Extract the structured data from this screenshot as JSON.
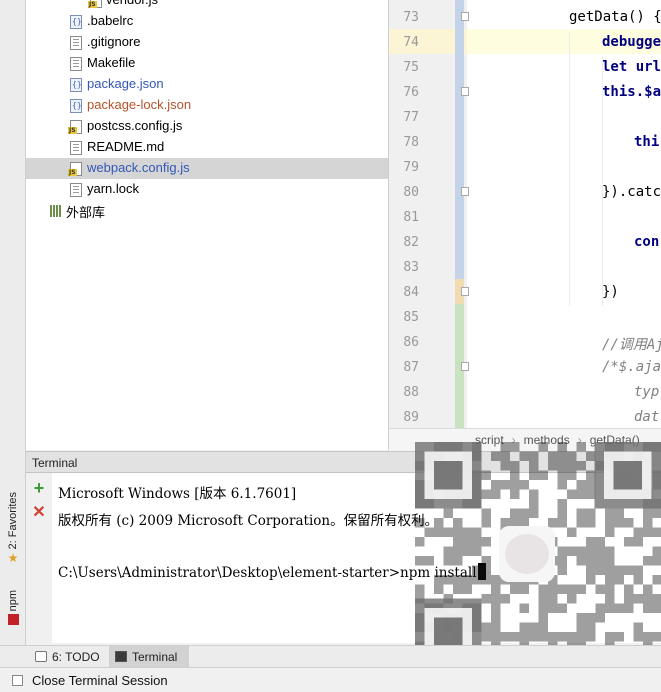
{
  "side_tabs": {
    "favorites": "2: Favorites",
    "npm": "npm"
  },
  "project_tree": {
    "items": [
      {
        "name": "vendor.js",
        "icon": "js-file-icon",
        "color": "#000000"
      },
      {
        "name": ".babelrc",
        "icon": "json-file-icon",
        "color": "#000000"
      },
      {
        "name": ".gitignore",
        "icon": "text-file-icon",
        "color": "#000000"
      },
      {
        "name": "Makefile",
        "icon": "text-file-icon",
        "color": "#000000"
      },
      {
        "name": "package.json",
        "icon": "json-file-icon",
        "color": "#3357b8"
      },
      {
        "name": "package-lock.json",
        "icon": "json-file-icon",
        "color": "#b5532a"
      },
      {
        "name": "postcss.config.js",
        "icon": "js-file-icon",
        "color": "#000000"
      },
      {
        "name": "README.md",
        "icon": "text-file-icon",
        "color": "#000000"
      },
      {
        "name": "webpack.config.js",
        "icon": "js-file-icon",
        "color": "#3357b8",
        "selected": true
      },
      {
        "name": "yarn.lock",
        "icon": "text-file-icon",
        "color": "#000000"
      },
      {
        "name": "外部库",
        "icon": "library-icon",
        "color": "#000000"
      }
    ]
  },
  "editor": {
    "lines": [
      {
        "num": "73",
        "text": "getData() {",
        "style": "plain"
      },
      {
        "num": "74",
        "text": "debugge",
        "style": "kw"
      },
      {
        "num": "75",
        "text": "let url",
        "style": "kw"
      },
      {
        "num": "76",
        "text": "this.$a",
        "style": "kw"
      },
      {
        "num": "77",
        "text": "",
        "style": "plain"
      },
      {
        "num": "78",
        "text": "thi",
        "style": "kw"
      },
      {
        "num": "79",
        "text": "",
        "style": "plain"
      },
      {
        "num": "80",
        "text": "}).catc",
        "style": "plain"
      },
      {
        "num": "81",
        "text": "",
        "style": "plain"
      },
      {
        "num": "82",
        "text": "con",
        "style": "kw"
      },
      {
        "num": "83",
        "text": "",
        "style": "plain"
      },
      {
        "num": "84",
        "text": "})",
        "style": "plain"
      },
      {
        "num": "85",
        "text": "",
        "style": "plain"
      },
      {
        "num": "86",
        "text": "//调用Aj",
        "style": "cm"
      },
      {
        "num": "87",
        "text": "/*$.aja",
        "style": "cm"
      },
      {
        "num": "88",
        "text": "typ",
        "style": "cm"
      },
      {
        "num": "89",
        "text": "dat",
        "style": "cm"
      }
    ],
    "breadcrumbs": [
      "script",
      "methods",
      "getData()"
    ],
    "current_line_color": "#fffde0"
  },
  "terminal": {
    "title": "Terminal",
    "lines": [
      "Microsoft Windows [版本 6.1.7601]",
      "版权所有 (c) 2009 Microsoft Corporation。保留所有权利。",
      "",
      "C:\\Users\\Administrator\\Desktop\\element-starter>npm install"
    ],
    "add_color": "#3a9a3a",
    "close_color": "#d04030"
  },
  "bottom_tabs": {
    "todo": "6: TODO",
    "terminal": "Terminal"
  },
  "status": {
    "text": "Close Terminal Session"
  }
}
